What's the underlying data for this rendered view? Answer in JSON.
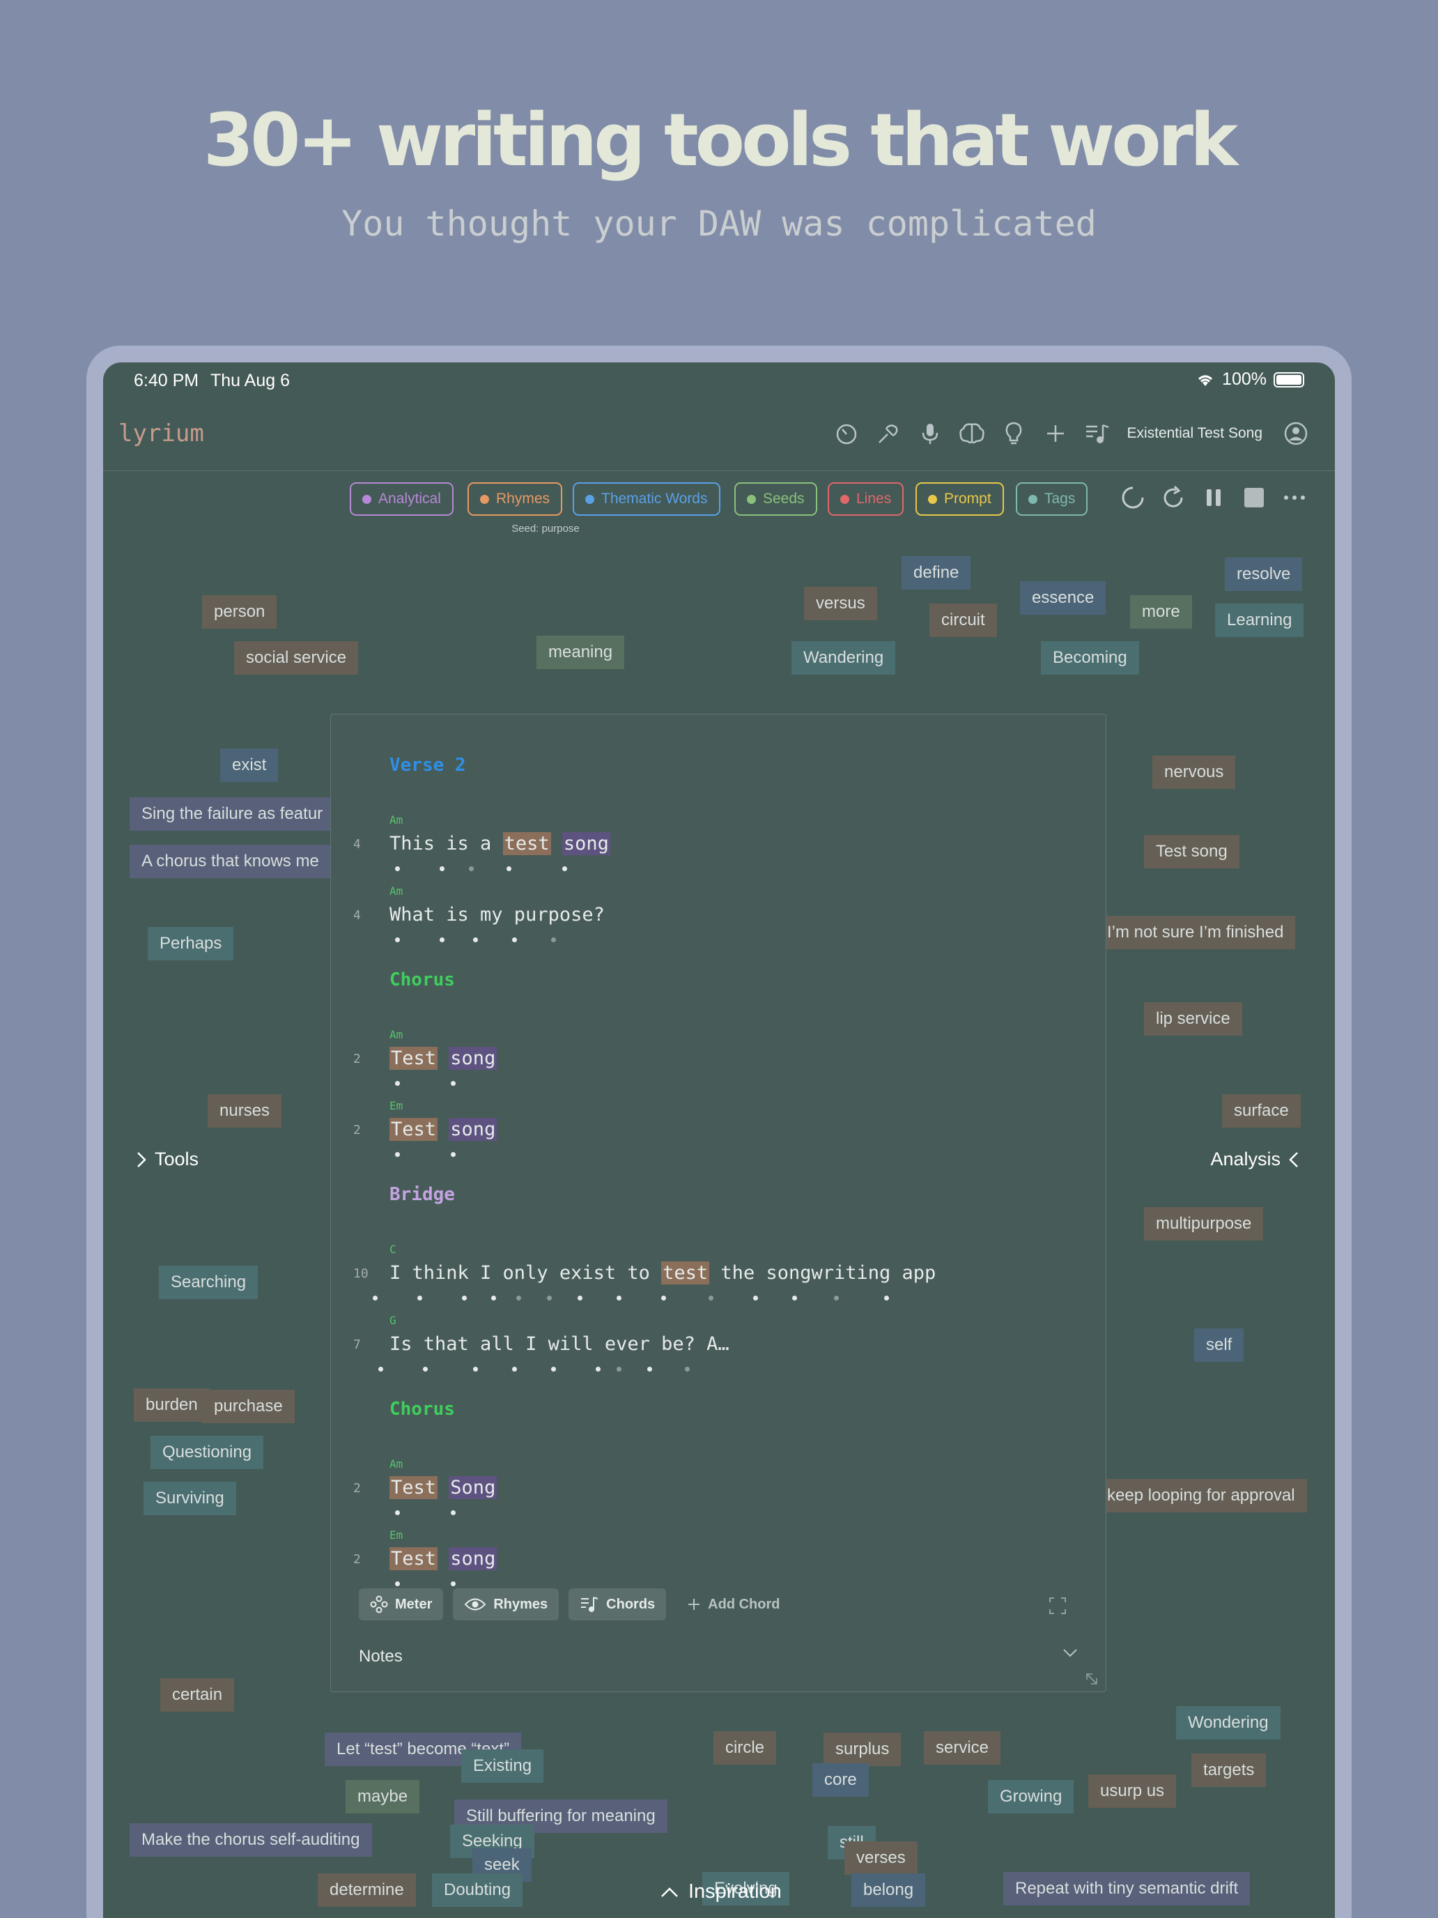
{
  "headline": "30+ writing tools that work",
  "subhead": "You thought your DAW was complicated",
  "status": {
    "time": "6:40 PM",
    "date": "Thu Aug 6",
    "battery": "100%"
  },
  "app": {
    "logo": "lyrium",
    "song_title": "Existential Test Song",
    "icons": [
      "timer-icon",
      "tuning-fork-icon",
      "microphone-icon",
      "brain-icon",
      "lightbulb-icon",
      "plus-icon",
      "music-list-icon",
      "profile-icon"
    ]
  },
  "filters": {
    "chips": [
      {
        "label": "Analytical",
        "color": "#b589d6"
      },
      {
        "label": "Rhymes",
        "color": "#e69a63"
      },
      {
        "label": "Thematic Words",
        "color": "#5aa0e6"
      },
      {
        "label": "Seeds",
        "color": "#8bc07c"
      },
      {
        "label": "Lines",
        "color": "#e0676a"
      },
      {
        "label": "Prompt",
        "color": "#e8c84a"
      },
      {
        "label": "Tags",
        "color": "#7fb8ae"
      }
    ],
    "seed_caption": "Seed: purpose",
    "controls": [
      "spinner-icon",
      "refresh-icon",
      "pause-icon",
      "stop-icon",
      "more-icon"
    ]
  },
  "words": [
    "person",
    "social service",
    "meaning",
    "versus",
    "define",
    "circuit",
    "essence",
    "more",
    "resolve",
    "Learning",
    "Wandering",
    "Becoming",
    "exist",
    "Sing the failure as featur",
    "A chorus that knows me",
    "Perhaps",
    "nervous",
    "Test song",
    "I’m not sure I’m finished",
    "lip service",
    "nurses",
    "surface",
    "multipurpose",
    "Searching",
    "self",
    "burden",
    "purchase",
    "Questioning",
    "Surviving",
    "keep looping for approval",
    "certain",
    "Let “test” become “text”",
    "Existing",
    "circle",
    "surplus",
    "service",
    "Wondering",
    "targets",
    "core",
    "maybe",
    "Growing",
    "usurp us",
    "Still buffering for meaning",
    "Make the chorus self-auditing",
    "Seeking",
    "still",
    "verses",
    "seek",
    "determine",
    "Doubting",
    "Evolving",
    "belong",
    "Repeat with tiny semantic drift"
  ],
  "side": {
    "tools": "Tools",
    "analysis": "Analysis"
  },
  "editor": {
    "sections": [
      {
        "title": "Verse 2",
        "color": "#2f8fe6"
      },
      {
        "title": "Chorus",
        "color": "#3fcf5c"
      },
      {
        "title": "Bridge",
        "color": "#c3a4e0"
      },
      {
        "title": "Chorus",
        "color": "#3fcf5c"
      }
    ],
    "lines": [
      {
        "chord": "Am",
        "num": "4",
        "parts": [
          "This is a ",
          "test",
          " ",
          "song"
        ]
      },
      {
        "chord": "Am",
        "num": "4",
        "text": "What is my purpose?"
      },
      {
        "chord": "Am",
        "num": "2",
        "parts": [
          "Test",
          " ",
          "song"
        ]
      },
      {
        "chord": "Em",
        "num": "2",
        "parts": [
          "Test",
          " ",
          "song"
        ]
      },
      {
        "chord": "C",
        "num": "10",
        "parts": [
          "I think I only exist to ",
          "test",
          " the songwriting app"
        ]
      },
      {
        "chord": "G",
        "num": "7",
        "text": "Is that all I will ever be? A…"
      },
      {
        "chord": "Am",
        "num": "2",
        "parts": [
          "Test",
          " ",
          "Song"
        ]
      },
      {
        "chord": "Em",
        "num": "2",
        "parts": [
          "Test",
          " ",
          "song"
        ]
      }
    ],
    "toolbar": {
      "meter": "Meter",
      "rhymes": "Rhymes",
      "chords": "Chords",
      "add_chord": "Add Chord"
    },
    "notes": "Notes"
  },
  "inspiration": "Inspiration"
}
